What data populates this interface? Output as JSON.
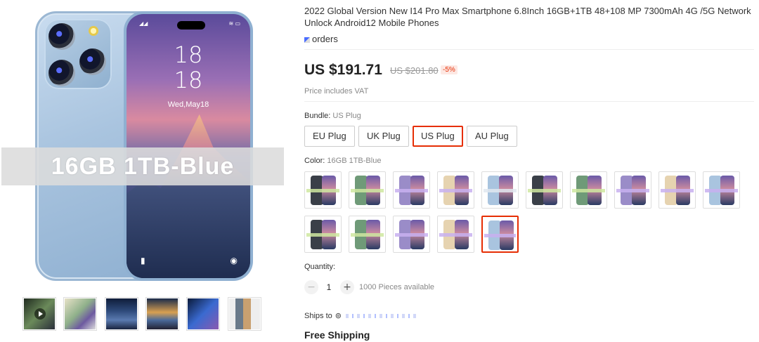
{
  "gallery": {
    "banner_text": "16GB 1TB-Blue",
    "lock_hour": "18",
    "lock_minute": "18",
    "lock_date": "Wed,May18",
    "thumbnails": [
      "video-thumbnail",
      "green-phone-thumbnail",
      "configuration-thumbnail",
      "features-thumbnail",
      "camera-thumbnail",
      "box-thumbnail"
    ]
  },
  "product": {
    "title": "2022 Global Version New I14 Pro Max Smartphone 6.8Inch 16GB+1TB 48+108 MP 7300mAh 4G /5G Network Unlock Android12 Mobile Phones",
    "orders_text": "orders",
    "price": "US $191.71",
    "old_price": "US $201.80",
    "discount": "-5%",
    "vat_note": "Price includes VAT",
    "accent_color": "#e62e04"
  },
  "bundle": {
    "label": "Bundle:",
    "selected": "US Plug",
    "options": [
      "EU Plug",
      "UK Plug",
      "US Plug",
      "AU Plug"
    ]
  },
  "color": {
    "label": "Color:",
    "selected": "16GB 1TB-Blue",
    "swatch_count": 15,
    "selected_index": 14
  },
  "quantity": {
    "label": "Quantity:",
    "minus": "−",
    "plus": "+",
    "value": "1",
    "available": "1000 Pieces available"
  },
  "shipping": {
    "label": "Ships to",
    "pin_icon": "location-pin-icon",
    "free_shipping": "Free Shipping"
  }
}
